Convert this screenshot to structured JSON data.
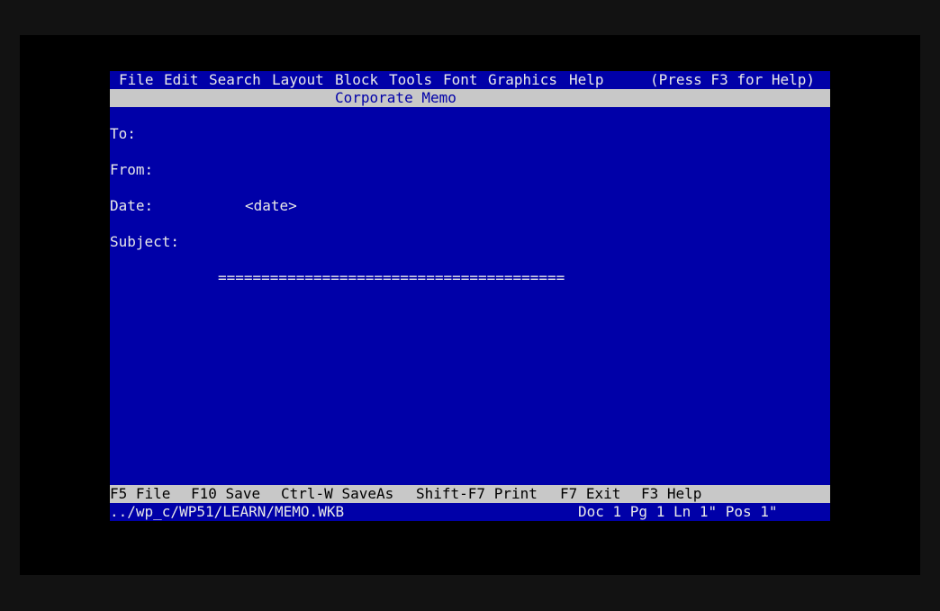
{
  "menu": {
    "items": [
      "File",
      "Edit",
      "Search",
      "Layout",
      "Block",
      "Tools",
      "Font",
      "Graphics",
      "Help"
    ],
    "help_hint": "(Press F3 for Help)"
  },
  "title_bar": {
    "title": "Corporate Memo"
  },
  "memo": {
    "to_label": "To:",
    "from_label": "From:",
    "date_label": "Date:",
    "date_value": "<date>",
    "subject_label": "Subject:",
    "separator": "========================================"
  },
  "function_keys": [
    {
      "key": "F5",
      "label": "File"
    },
    {
      "key": "F10",
      "label": "Save"
    },
    {
      "key": "Ctrl-W",
      "label": "SaveAs"
    },
    {
      "key": "Shift-F7",
      "label": "Print"
    },
    {
      "key": "F7",
      "label": "Exit"
    },
    {
      "key": "F3",
      "label": "Help"
    }
  ],
  "status": {
    "path": "../wp_c/WP51/LEARN/MEMO.WKB",
    "position": "Doc 1 Pg 1 Ln 1\" Pos 1\""
  },
  "colors": {
    "background": "#0000a8",
    "bar": "#c8c8c8",
    "text": "#e8e8e8"
  }
}
